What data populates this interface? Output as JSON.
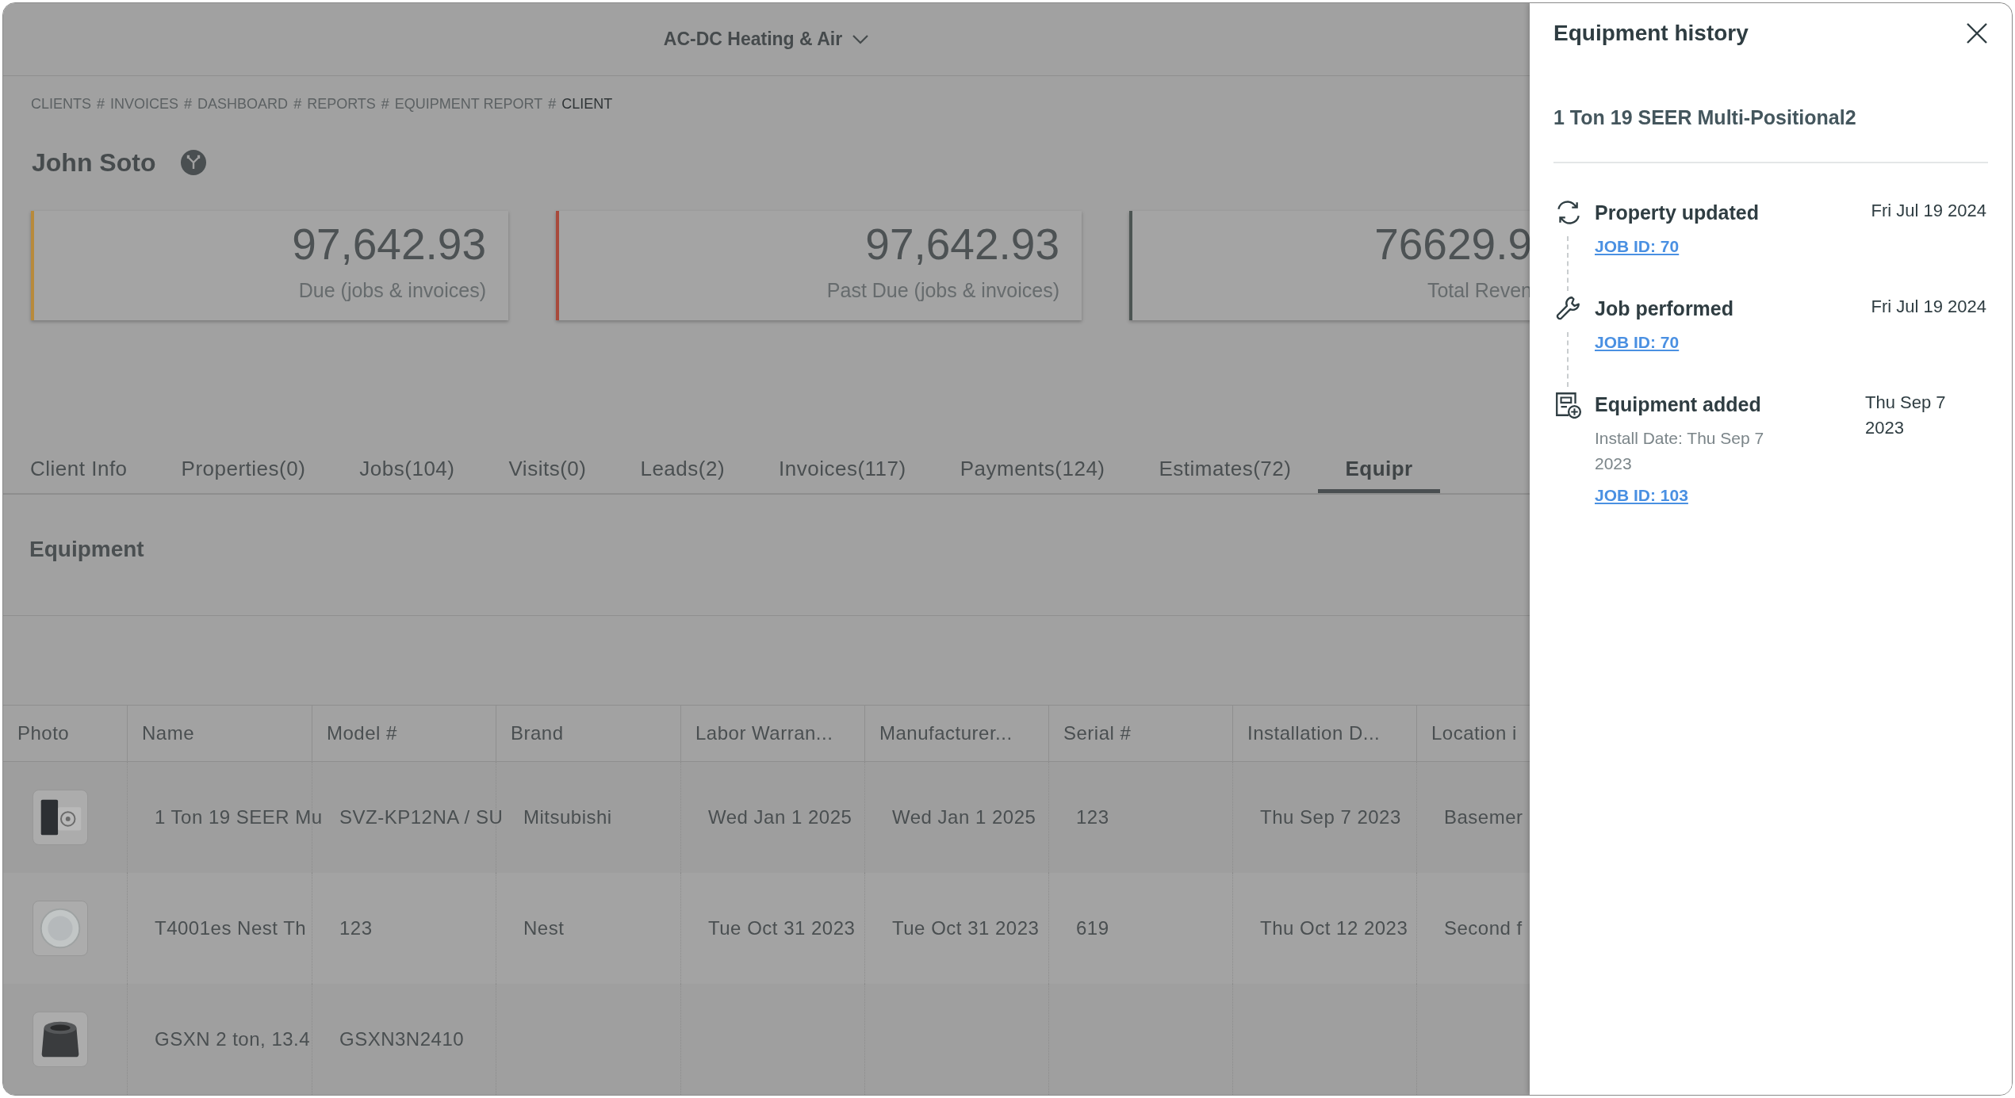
{
  "header": {
    "company": "AC-DC Heating & Air"
  },
  "breadcrumb": {
    "separator": "#",
    "items": [
      {
        "label": "CLIENTS",
        "current": false
      },
      {
        "label": "INVOICES",
        "current": false
      },
      {
        "label": "DASHBOARD",
        "current": false
      },
      {
        "label": "REPORTS",
        "current": false
      },
      {
        "label": "EQUIPMENT REPORT",
        "current": false
      },
      {
        "label": "CLIENT",
        "current": true
      }
    ]
  },
  "client": {
    "name": "John Soto"
  },
  "summary_cards": [
    {
      "value": "97,642.93",
      "label": "Due (jobs & invoices)",
      "color": "#b88a3c"
    },
    {
      "value": "97,642.93",
      "label": "Past Due (jobs & invoices)",
      "color": "#a84a3c"
    },
    {
      "value": "76629.9",
      "label": "Total Reven",
      "color": "#4c5553"
    }
  ],
  "tabs": [
    {
      "label": "Client Info",
      "selected": false
    },
    {
      "label": "Properties(0)",
      "selected": false
    },
    {
      "label": "Jobs(104)",
      "selected": false
    },
    {
      "label": "Visits(0)",
      "selected": false
    },
    {
      "label": "Leads(2)",
      "selected": false
    },
    {
      "label": "Invoices(117)",
      "selected": false
    },
    {
      "label": "Payments(124)",
      "selected": false
    },
    {
      "label": "Estimates(72)",
      "selected": false
    },
    {
      "label": "Equipr",
      "selected": true
    }
  ],
  "section": {
    "title": "Equipment"
  },
  "table": {
    "columns": [
      "Photo",
      "Name",
      "Model #",
      "Brand",
      "Labor Warran...",
      "Manufacturer...",
      "Serial #",
      "Installation D...",
      "Location i"
    ],
    "rows": [
      {
        "kind": "split-unit",
        "cells": [
          "",
          "1 Ton 19 SEER Mu",
          "SVZ-KP12NA / SU",
          "Mitsubishi",
          "Wed Jan 1 2025",
          "Wed Jan 1 2025",
          "123",
          "Thu Sep 7 2023",
          "Basemer"
        ]
      },
      {
        "kind": "thermostat",
        "cells": [
          "",
          "T4001es Nest Th",
          "123",
          "Nest",
          "Tue Oct 31 2023",
          "Tue Oct 31 2023",
          "619",
          "Thu Oct 12 2023",
          "Second f"
        ]
      },
      {
        "kind": "condenser",
        "cells": [
          "",
          "GSXN 2 ton, 13.4",
          "GSXN3N2410",
          "",
          "",
          "",
          "",
          "",
          ""
        ]
      }
    ]
  },
  "panel": {
    "title": "Equipment history",
    "equipment_name": "1 Ton 19 SEER Multi-Positional2",
    "events": [
      {
        "kind": "update",
        "title": "Property updated",
        "date": "Fri Jul 19 2024",
        "link": "JOB ID: 70"
      },
      {
        "kind": "job",
        "title": "Job performed",
        "date": "Fri Jul 19 2024",
        "link": "JOB ID: 70"
      },
      {
        "kind": "added",
        "title": "Equipment added",
        "date": "Thu Sep 7 2023",
        "detail": "Install Date: Thu Sep 7 2023",
        "link": "JOB ID: 103"
      }
    ]
  }
}
